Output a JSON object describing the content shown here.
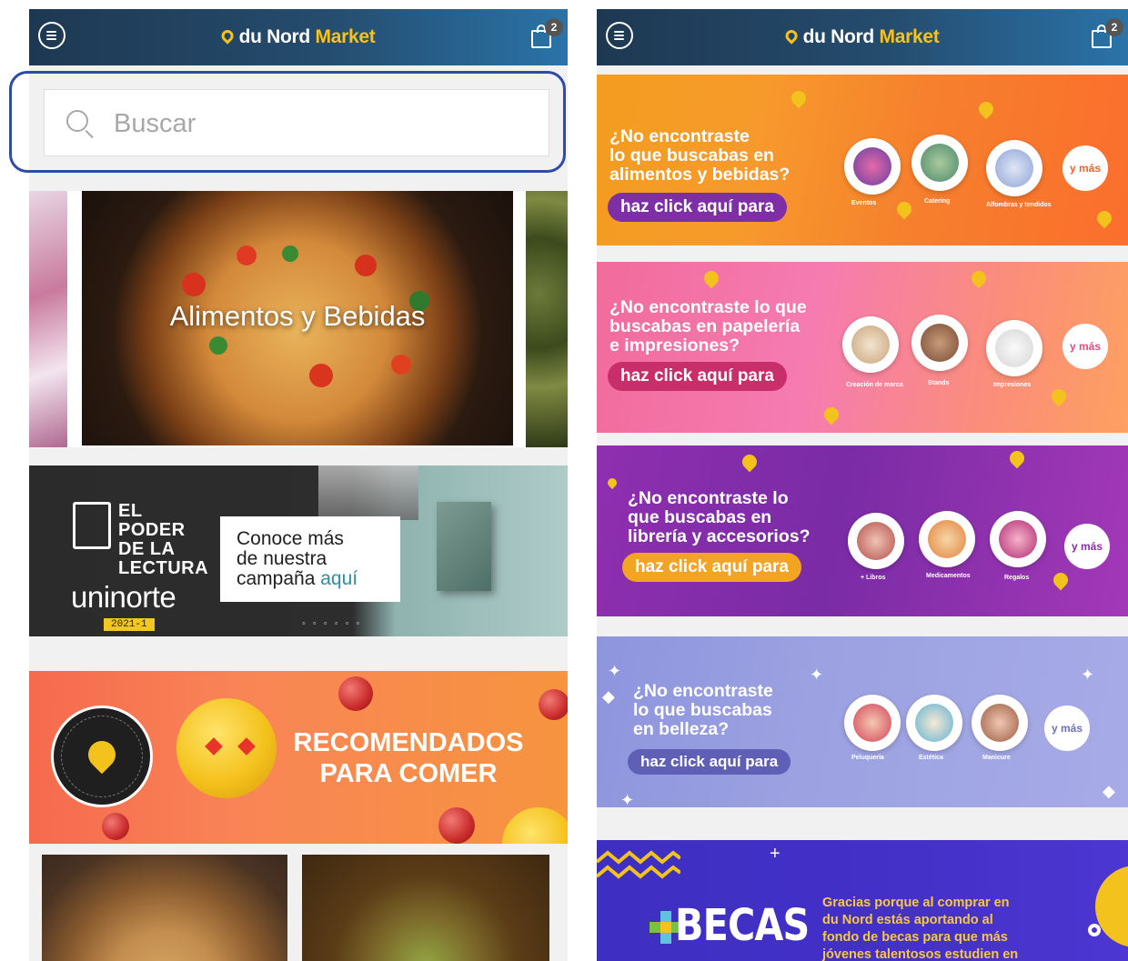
{
  "header": {
    "logo_prefix": "du Nord",
    "logo_suffix": "Market",
    "cart_count": "2"
  },
  "search": {
    "placeholder": "Buscar"
  },
  "left": {
    "category_title": "Alimentos y Bebidas",
    "campaign": {
      "line1": "EL PODER",
      "line2": "DE LA",
      "line3": "LECTURA",
      "brand": "uninorte",
      "year": "2021-1",
      "card_text_1": "Conoce más",
      "card_text_2": "de nuestra",
      "card_text_3": "campaña",
      "card_link": "aquí"
    },
    "promo": {
      "title_1": "RECOMENDADOS",
      "title_2": "PARA COMER"
    }
  },
  "right": {
    "banners": [
      {
        "q1": "¿No encontraste",
        "q2": "lo que buscabas en",
        "q3": "alimentos y bebidas?",
        "cta": "haz click aquí para",
        "more": "y más",
        "items": [
          "Eventos",
          "Catering",
          "Alfombras y tendidos"
        ]
      },
      {
        "q1": "¿No encontraste lo que",
        "q2": "buscabas en papelería",
        "q3": "e impresiones?",
        "cta": "haz click aquí para",
        "more": "y más",
        "items": [
          "Creación de marca",
          "Stands",
          "Impresiones"
        ]
      },
      {
        "q1": "¿No encontraste lo",
        "q2": "que buscabas en",
        "q3": "librería y accesorios?",
        "cta": "haz click aquí para",
        "more": "y más",
        "items": [
          "+ Libros",
          "Medicamentos",
          "Regalos"
        ]
      },
      {
        "q1": "¿No encontraste",
        "q2": "lo que buscabas",
        "q3": "en belleza?",
        "cta": "haz click aquí para",
        "more": "y más",
        "items": [
          "Peluquería",
          "Estética",
          "Manicure"
        ]
      }
    ],
    "becas": {
      "title": "BECAS",
      "text_1": "Gracias porque al comprar en",
      "text_2": "du Nord estás aportando al",
      "text_3": "fondo de becas para que más",
      "text_4": "jóvenes talentosos estudien en"
    }
  },
  "colors": {
    "header_dark": "#1e3852",
    "header_light": "#2a73a8",
    "accent_yellow": "#f7c21b",
    "highlight_ring": "#2f4aa8"
  },
  "icons": [
    "menu-icon",
    "location-pin-icon",
    "cart-icon",
    "search-icon"
  ]
}
